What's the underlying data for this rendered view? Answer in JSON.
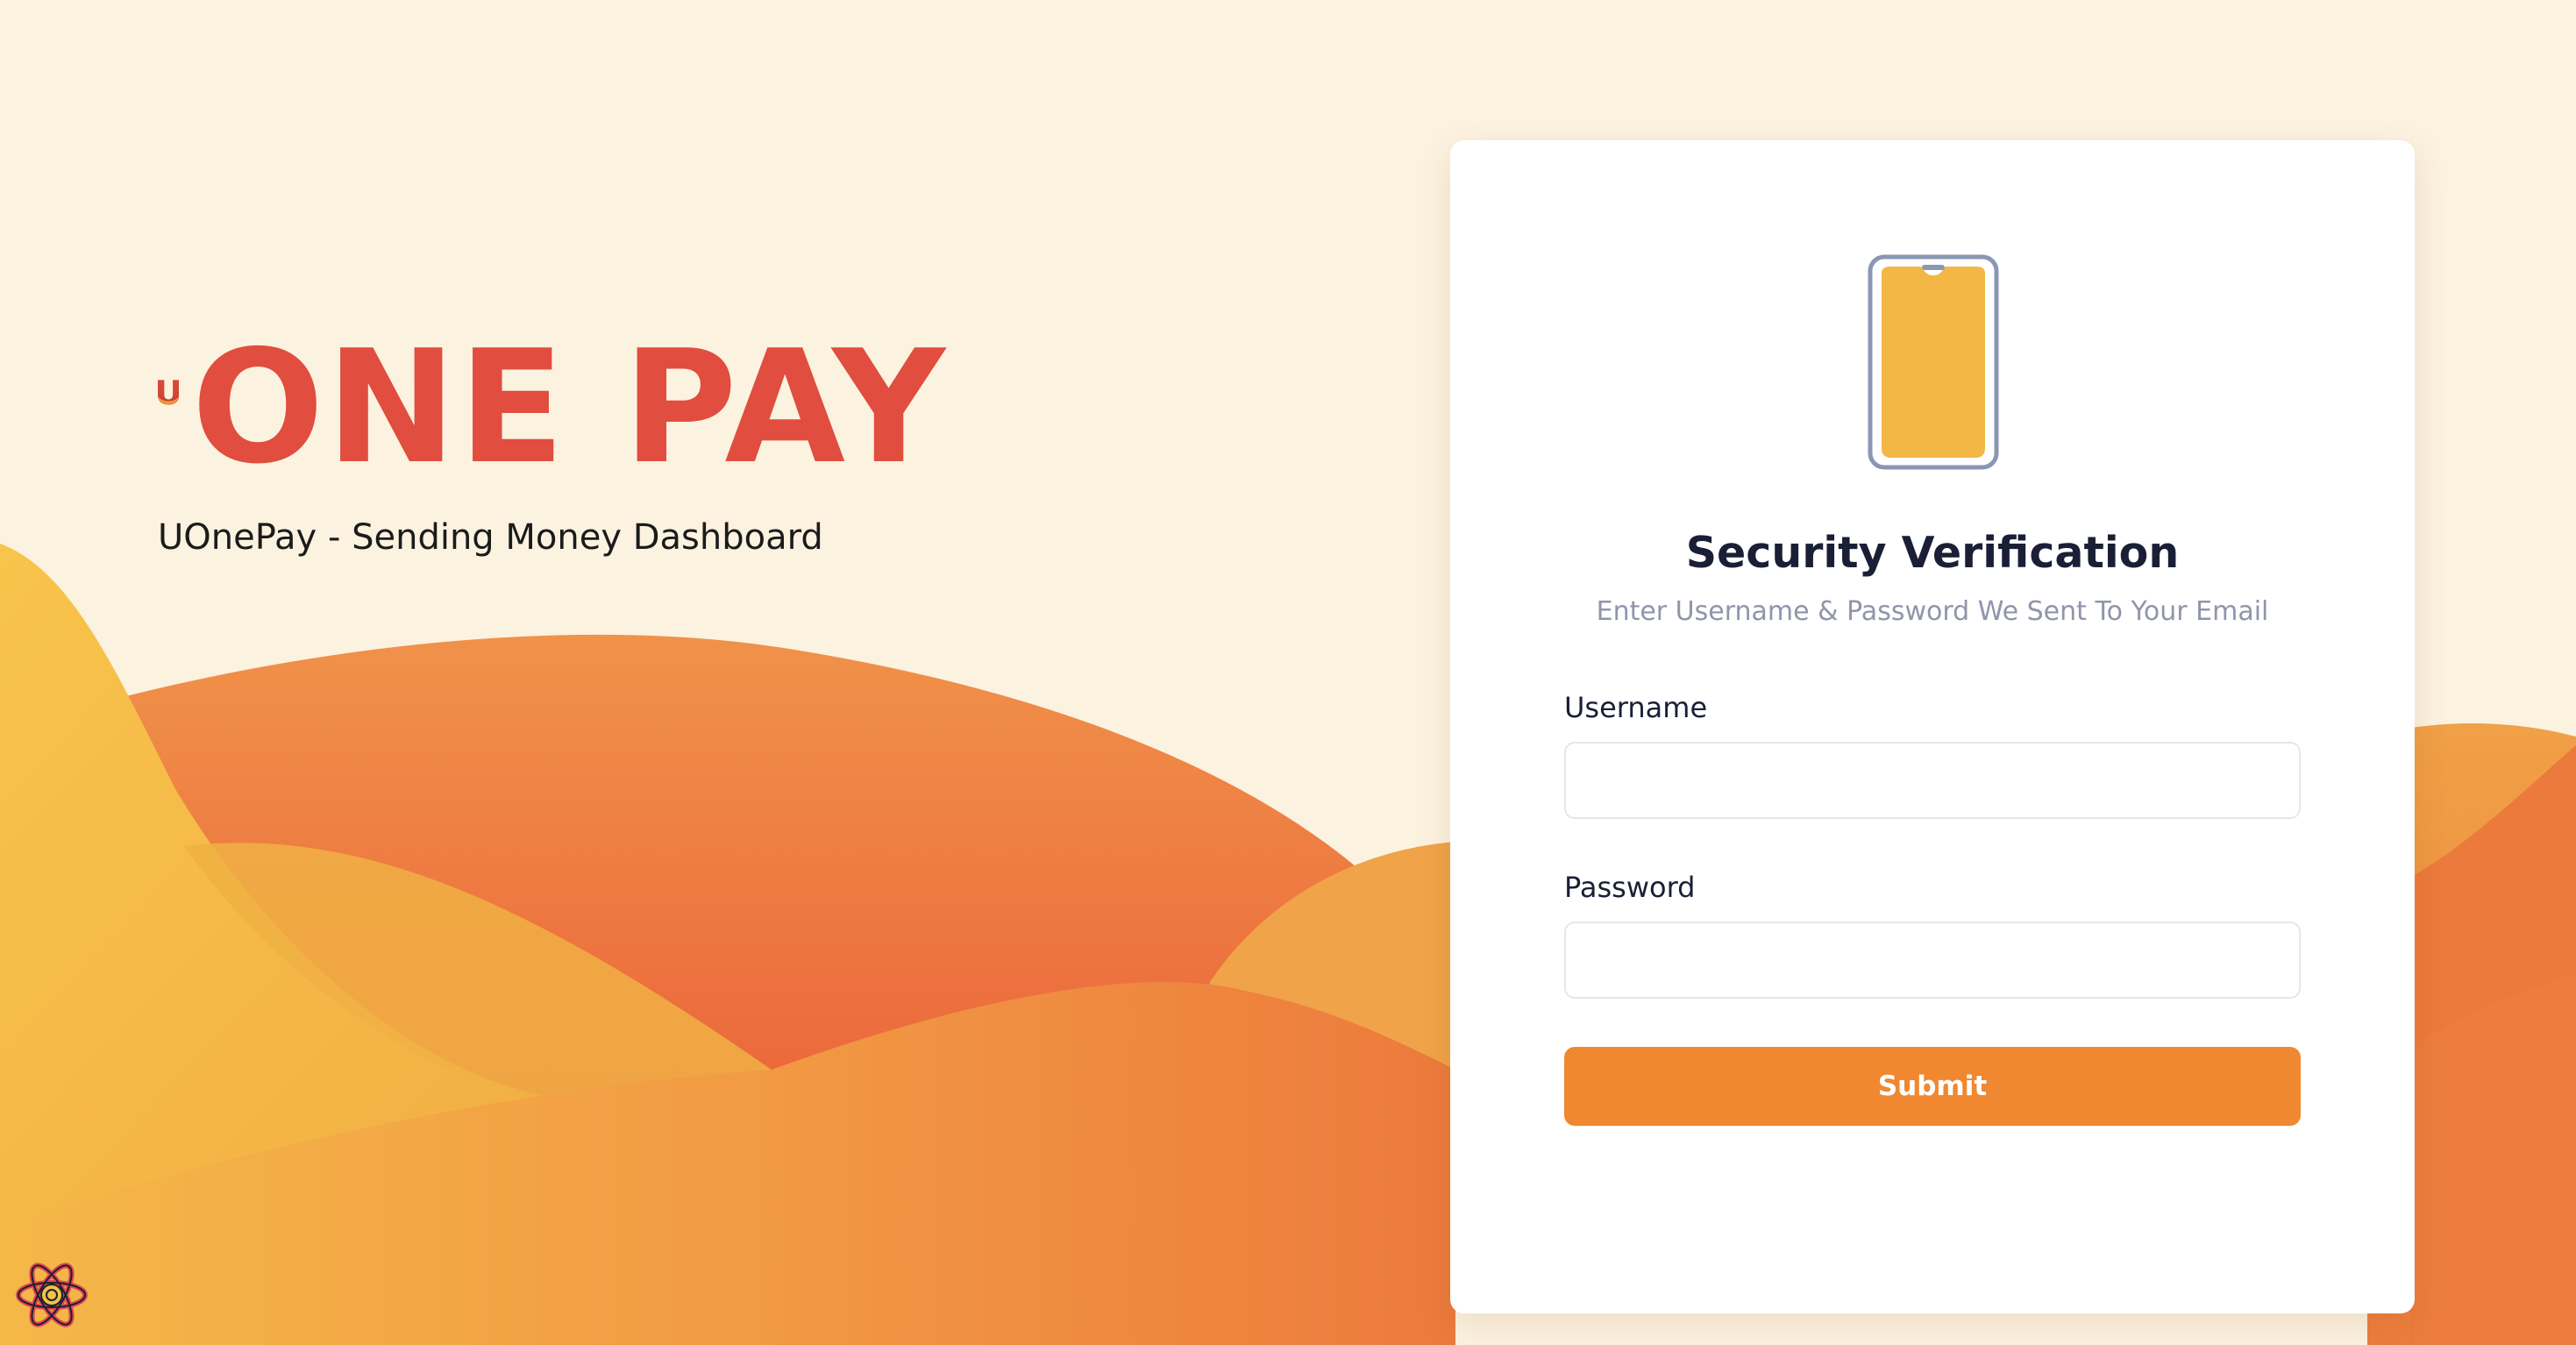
{
  "brand": {
    "logo_text": "ONE PAY",
    "tagline": "UOnePay - Sending Money Dashboard",
    "colors": {
      "primary_red": "#e14d3e",
      "gold": "#f3b743",
      "accent_orange": "#ef8831",
      "background": "#fcf2e0"
    }
  },
  "card": {
    "icon": "phone-icon",
    "title": "Security Verification",
    "subtitle": "Enter Username & Password We Sent To Your Email",
    "fields": [
      {
        "label": "Username",
        "value": "",
        "placeholder": ""
      },
      {
        "label": "Password",
        "value": "",
        "placeholder": ""
      }
    ],
    "submit_label": "Submit"
  },
  "floating_badge": {
    "icon": "react-icon"
  }
}
